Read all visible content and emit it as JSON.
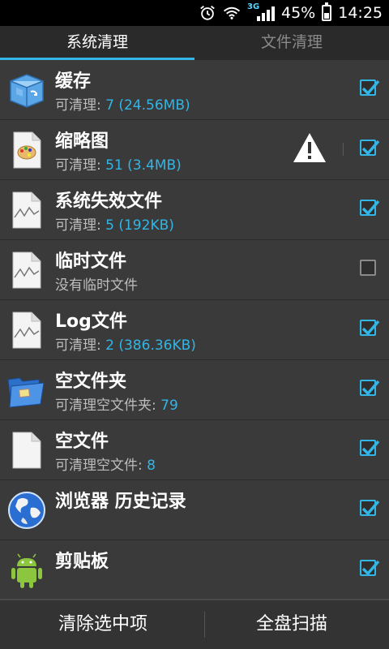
{
  "status": {
    "alarm_icon": "alarm-clock-icon",
    "wifi_icon": "wifi-icon",
    "network": "3G",
    "signal_icon": "signal-bars-icon",
    "battery": "45%",
    "battery_level": 0.45,
    "time": "14:25"
  },
  "tabs": [
    {
      "label": "系统清理",
      "active": true
    },
    {
      "label": "文件清理",
      "active": false
    }
  ],
  "accent": "#33b5e5",
  "items": [
    {
      "title": "缓存",
      "sub_prefix": "可清理: ",
      "sub_value": "7 (24.56MB)",
      "icon": "cache-box-icon",
      "checked": true,
      "warning": false
    },
    {
      "title": "缩略图",
      "sub_prefix": "可清理: ",
      "sub_value": "51 (3.4MB)",
      "icon": "palette-file-icon",
      "checked": true,
      "warning": true
    },
    {
      "title": "系统失效文件",
      "sub_prefix": "可清理: ",
      "sub_value": "5 (192KB)",
      "icon": "broken-file-icon",
      "checked": true,
      "warning": false
    },
    {
      "title": "临时文件",
      "sub_prefix": "没有临时文件",
      "sub_value": "",
      "icon": "broken-file-icon",
      "checked": false,
      "warning": false
    },
    {
      "title": "Log文件",
      "sub_prefix": "可清理: ",
      "sub_value": "2 (386.36KB)",
      "icon": "broken-file-icon",
      "checked": true,
      "warning": false
    },
    {
      "title": "空文件夹",
      "sub_prefix": "可清理空文件夹: ",
      "sub_value": "79",
      "icon": "folder-icon",
      "checked": true,
      "warning": false
    },
    {
      "title": "空文件",
      "sub_prefix": "可清理空文件: ",
      "sub_value": "8",
      "icon": "blank-file-icon",
      "checked": true,
      "warning": false
    },
    {
      "title": "浏览器 历史记录",
      "sub_prefix": "",
      "sub_value": "",
      "icon": "globe-icon",
      "checked": true,
      "warning": false
    },
    {
      "title": "剪贴板",
      "sub_prefix": "",
      "sub_value": "",
      "icon": "android-icon",
      "checked": true,
      "warning": false
    }
  ],
  "buttons": {
    "clear_selected": "清除选中项",
    "full_scan": "全盘扫描"
  }
}
